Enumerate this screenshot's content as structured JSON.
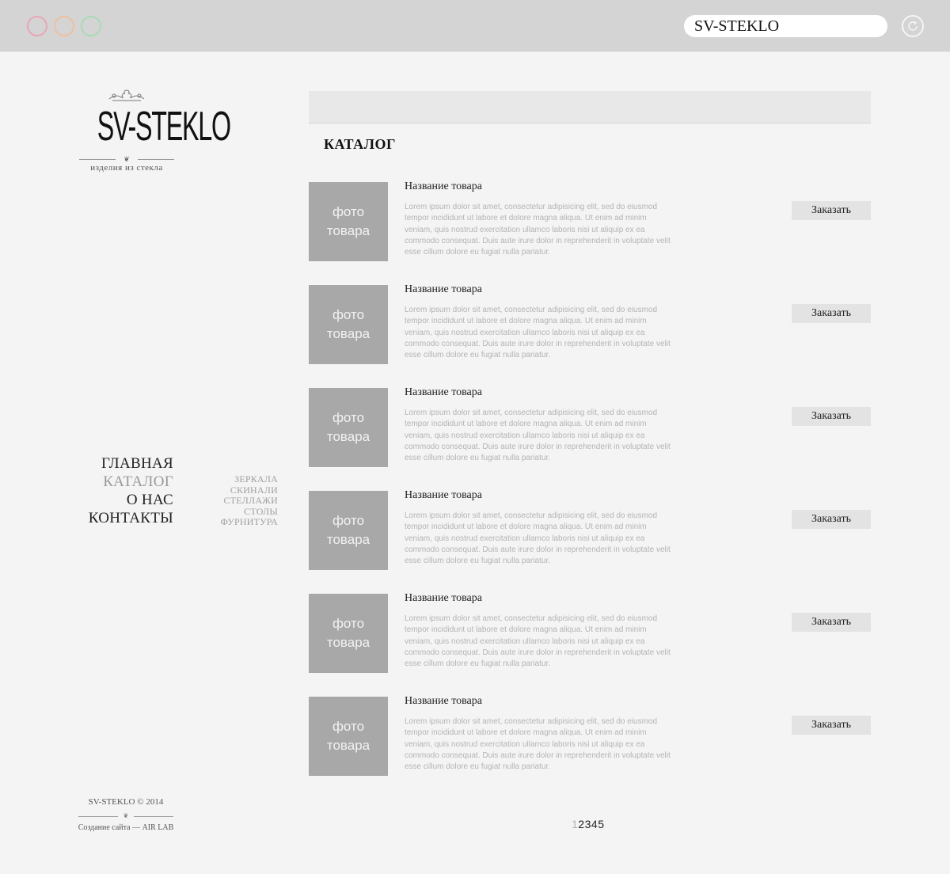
{
  "browser": {
    "address": "SV-STEKLO"
  },
  "logo": {
    "text": "SV-STEKLO",
    "tagline": "изделия из стекла"
  },
  "main_nav": [
    {
      "label": "ГЛАВНАЯ",
      "active": false
    },
    {
      "label": "КАТАЛОГ",
      "active": true
    },
    {
      "label": "О НАС",
      "active": false
    },
    {
      "label": "КОНТАКТЫ",
      "active": false
    }
  ],
  "sub_nav": [
    "ЗЕРКАЛА",
    "СКИНАЛИ",
    "СТЕЛЛАЖИ",
    "СТОЛЫ",
    "ФУРНИТУРА"
  ],
  "footer": {
    "copyright": "SV-STEKLO © 2014",
    "credit": "Создание сайта — AIR LAB"
  },
  "catalog": {
    "title": "КАТАЛОГ",
    "items": [
      {
        "photo_line1": "фото",
        "photo_line2": "товара",
        "name": "Название товара",
        "description": "Lorem ipsum dolor sit amet, consectetur adipisicing elit, sed do eiusmod tempor incididunt ut labore et dolore magna aliqua. Ut enim ad minim veniam, quis nostrud exercitation ullamco laboris nisi ut aliquip ex ea commodo consequat. Duis aute irure dolor in reprehenderit in voluptate velit esse cillum dolore eu fugiat nulla pariatur.",
        "order_label": "Заказать"
      },
      {
        "photo_line1": "фото",
        "photo_line2": "товара",
        "name": "Название товара",
        "description": "Lorem ipsum dolor sit amet, consectetur adipisicing elit, sed do eiusmod tempor incididunt ut labore et dolore magna aliqua. Ut enim ad minim veniam, quis nostrud exercitation ullamco laboris nisi ut aliquip ex ea commodo consequat. Duis aute irure dolor in reprehenderit in voluptate velit esse cillum dolore eu fugiat nulla pariatur.",
        "order_label": "Заказать"
      },
      {
        "photo_line1": "фото",
        "photo_line2": "товара",
        "name": "Название товара",
        "description": "Lorem ipsum dolor sit amet, consectetur adipisicing elit, sed do eiusmod tempor incididunt ut labore et dolore magna aliqua. Ut enim ad minim veniam, quis nostrud exercitation ullamco laboris nisi ut aliquip ex ea commodo consequat. Duis aute irure dolor in reprehenderit in voluptate velit esse cillum dolore eu fugiat nulla pariatur.",
        "order_label": "Заказать"
      },
      {
        "photo_line1": "фото",
        "photo_line2": "товара",
        "name": "Название товара",
        "description": "Lorem ipsum dolor sit amet, consectetur adipisicing elit, sed do eiusmod tempor incididunt ut labore et dolore magna aliqua. Ut enim ad minim veniam, quis nostrud exercitation ullamco laboris nisi ut aliquip ex ea commodo consequat. Duis aute irure dolor in reprehenderit in voluptate velit esse cillum dolore eu fugiat nulla pariatur.",
        "order_label": "Заказать"
      },
      {
        "photo_line1": "фото",
        "photo_line2": "товара",
        "name": "Название товара",
        "description": "Lorem ipsum dolor sit amet, consectetur adipisicing elit, sed do eiusmod tempor incididunt ut labore et dolore magna aliqua. Ut enim ad minim veniam, quis nostrud exercitation ullamco laboris nisi ut aliquip ex ea commodo consequat. Duis aute irure dolor in reprehenderit in voluptate velit esse cillum dolore eu fugiat nulla pariatur.",
        "order_label": "Заказать"
      },
      {
        "photo_line1": "фото",
        "photo_line2": "товара",
        "name": "Название товара",
        "description": "Lorem ipsum dolor sit amet, consectetur adipisicing elit, sed do eiusmod tempor incididunt ut labore et dolore magna aliqua. Ut enim ad minim veniam, quis nostrud exercitation ullamco laboris nisi ut aliquip ex ea commodo consequat. Duis aute irure dolor in reprehenderit in voluptate velit esse cillum dolore eu fugiat nulla pariatur.",
        "order_label": "Заказать"
      }
    ]
  },
  "pagination": {
    "pages": [
      "1",
      "2",
      "3",
      "4",
      "5"
    ],
    "current": "1"
  }
}
